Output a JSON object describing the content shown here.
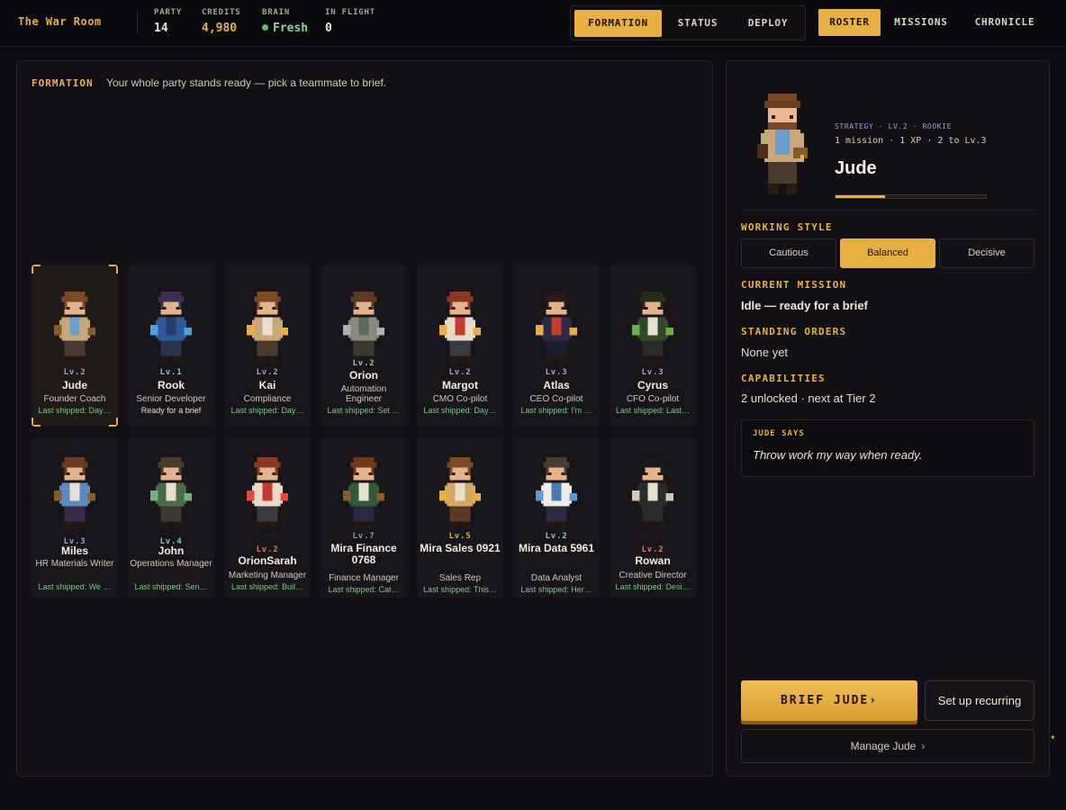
{
  "app": {
    "title": "The War Room"
  },
  "stats": [
    {
      "label": "PARTY",
      "value": "14",
      "tone": "plain"
    },
    {
      "label": "CREDITS",
      "value": "4,980",
      "tone": "gold"
    },
    {
      "label": "BRAIN",
      "value": "Fresh",
      "tone": "green",
      "dot": true
    },
    {
      "label": "IN FLIGHT",
      "value": "0",
      "tone": "plain"
    }
  ],
  "view_tabs": [
    {
      "label": "FORMATION",
      "active": true
    },
    {
      "label": "STATUS",
      "active": false
    },
    {
      "label": "DEPLOY",
      "active": false
    }
  ],
  "nav_tabs": [
    {
      "label": "ROSTER",
      "active": true
    },
    {
      "label": "MISSIONS",
      "active": false
    },
    {
      "label": "CHRONICLE",
      "active": false
    }
  ],
  "formation": {
    "title": "FORMATION",
    "subtitle": "Your whole party stands ready — pick a teammate to brief."
  },
  "roster": [
    {
      "name": "Jude",
      "level": "Lv.2",
      "role": "Founder Coach",
      "status": "Last shipped: Day…",
      "selected": true
    },
    {
      "name": "Rook",
      "level": "Lv.1",
      "role": "Senior Developer",
      "status": "Ready for a brief"
    },
    {
      "name": "Kai",
      "level": "Lv.2",
      "role": "Compliance",
      "status": "Last shipped: Day…"
    },
    {
      "name": "Orion",
      "level": "Lv.2",
      "role": "Automation Engineer",
      "status": "Last shipped: Set …"
    },
    {
      "name": "Margot",
      "level": "Lv.2",
      "role": "CMO Co-pilot",
      "status": "Last shipped: Day…"
    },
    {
      "name": "Atlas",
      "level": "Lv.3",
      "role": "CEO Co-pilot",
      "status": "Last shipped: I'm …"
    },
    {
      "name": "Cyrus",
      "level": "Lv.3",
      "role": "CFO Co-pilot",
      "status": "Last shipped: Last…"
    },
    {
      "name": "Miles",
      "level": "Lv.3",
      "role": "HR Materials Writer",
      "status": "Last shipped: We …"
    },
    {
      "name": "John",
      "level": "Lv.4",
      "role": "Operations Manager",
      "status": "Last shipped: Sen…"
    },
    {
      "name": "OrionSarah",
      "level": "Lv.2",
      "role": "Marketing Manager",
      "status": "Last shipped: Buil…"
    },
    {
      "name": "Mira Finance 0768",
      "level": "Lv.7",
      "role": "Finance Manager",
      "status": "Last shipped: Cat…"
    },
    {
      "name": "Mira Sales 0921",
      "level": "Lv.5",
      "role": "Sales Rep",
      "status": "Last shipped: This…"
    },
    {
      "name": "Mira Data 5961",
      "level": "Lv.2",
      "role": "Data Analyst",
      "status": "Last shipped: Her…"
    },
    {
      "name": "Rowan",
      "level": "Lv.2",
      "role": "Creative Director",
      "status": "Last shipped: Desi…"
    }
  ],
  "detail": {
    "tag": "STRATEGY · LV.2 · ROOKIE",
    "xp_line": "1 mission · 1 XP · 2 to Lv.3",
    "name": "Jude",
    "xp_progress": 0.33,
    "working_style_label": "WORKING STYLE",
    "styles": [
      {
        "label": "Cautious",
        "active": false
      },
      {
        "label": "Balanced",
        "active": true
      },
      {
        "label": "Decisive",
        "active": false
      }
    ],
    "current_mission_label": "CURRENT MISSION",
    "current_mission": "Idle — ready for a brief",
    "standing_orders_label": "STANDING ORDERS",
    "standing_orders": "None yet",
    "capabilities_label": "CAPABILITIES",
    "capabilities": "2 unlocked · next at Tier 2",
    "says_title": "JUDE SAYS",
    "says_quote": "Throw work my way when ready.",
    "brief_button": "BRIEF JUDE›",
    "recurring_button": "Set up recurring",
    "manage_button": "Manage Jude",
    "manage_chevron": "›"
  },
  "colors": {
    "accent": "#e8b043",
    "background": "#0d0b10",
    "panel": "#121015",
    "shipped_green": "#7fc58a"
  }
}
